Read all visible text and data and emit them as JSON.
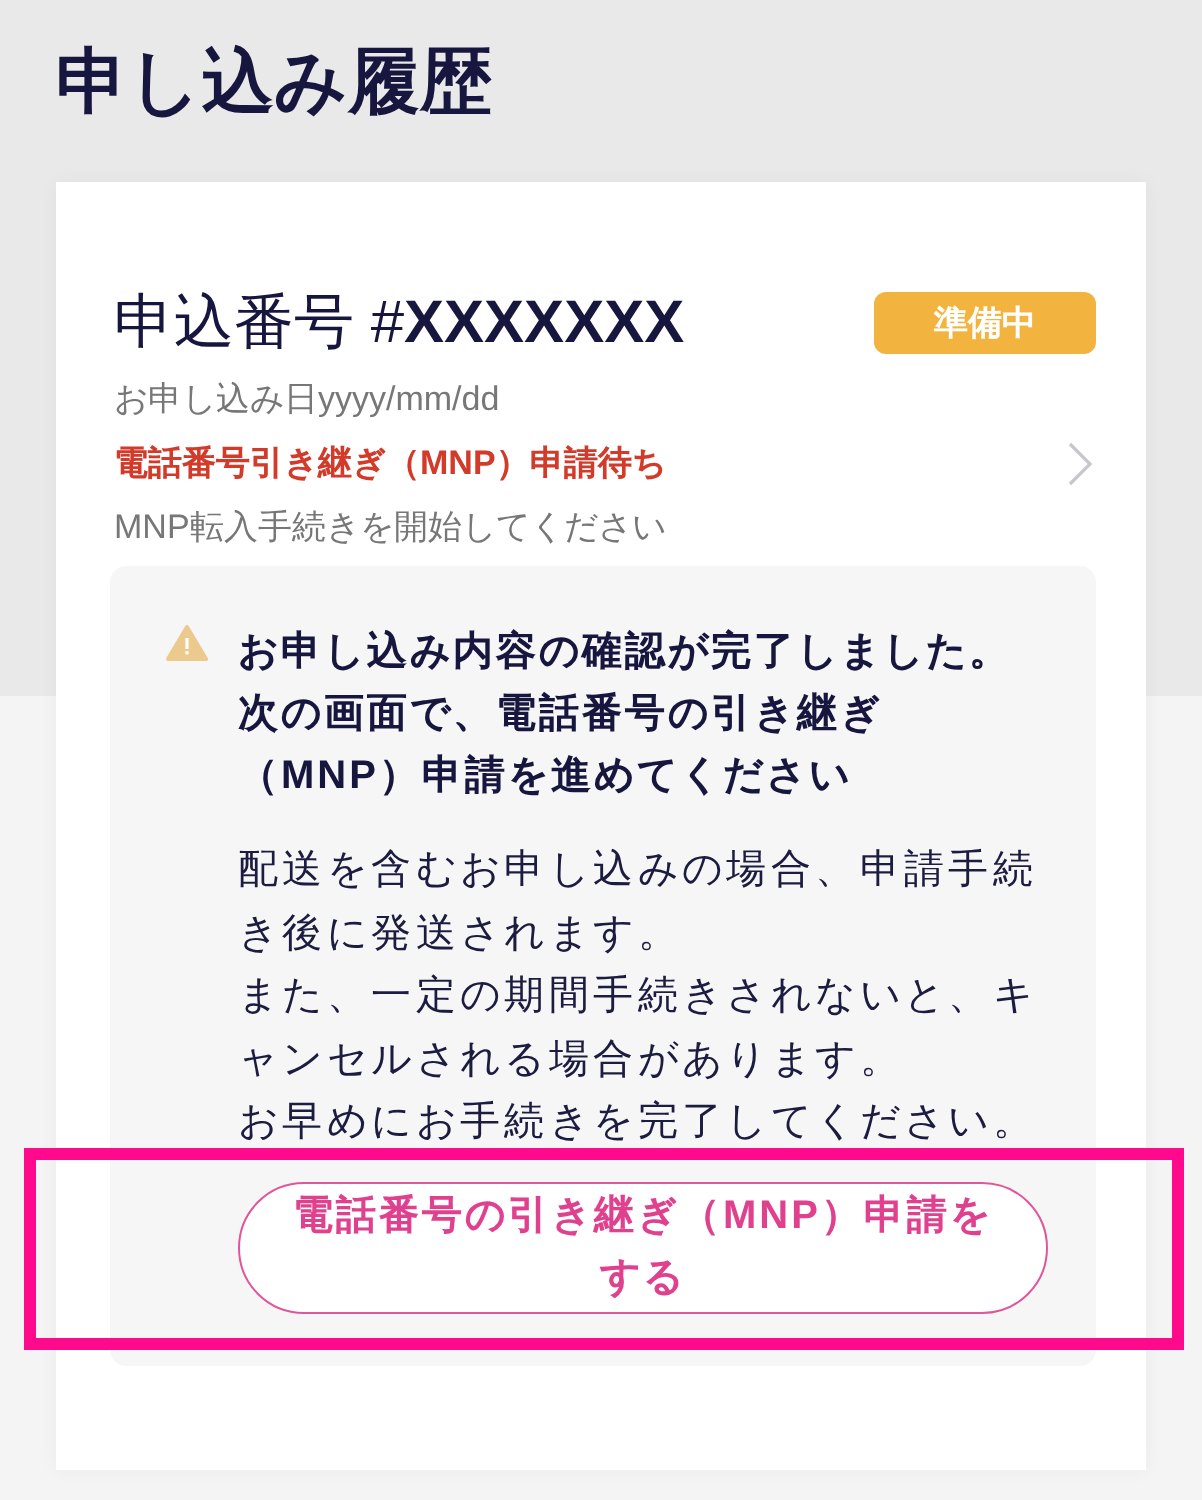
{
  "page": {
    "title": "申し込み履歴"
  },
  "application": {
    "number_label": "申込番号 #**XXXXXXX**",
    "status_badge": "準備中",
    "date": "お申し込み日yyyy/mm/dd",
    "alert": "電話番号引き継ぎ（MNP）申請待ち",
    "instruction": "MNP転入手続きを開始してください",
    "notice": {
      "kind": "warning",
      "title": [
        "お申し込み内容の確認が完了しました。",
        "次の画面で、電話番号の引き継ぎ（MNP）申請を進めてください"
      ],
      "body": [
        "配送を含むお申し込みの場合、申請手続き後に発送されます。",
        "また、一定の期間手続きされないと、キャンセルされる場合があります。",
        "お早めにお手続きを完了してください。"
      ]
    },
    "action_button": {
      "label": "電話番号の引き継ぎ（MNP）申請をする",
      "highlighted": true
    }
  }
}
